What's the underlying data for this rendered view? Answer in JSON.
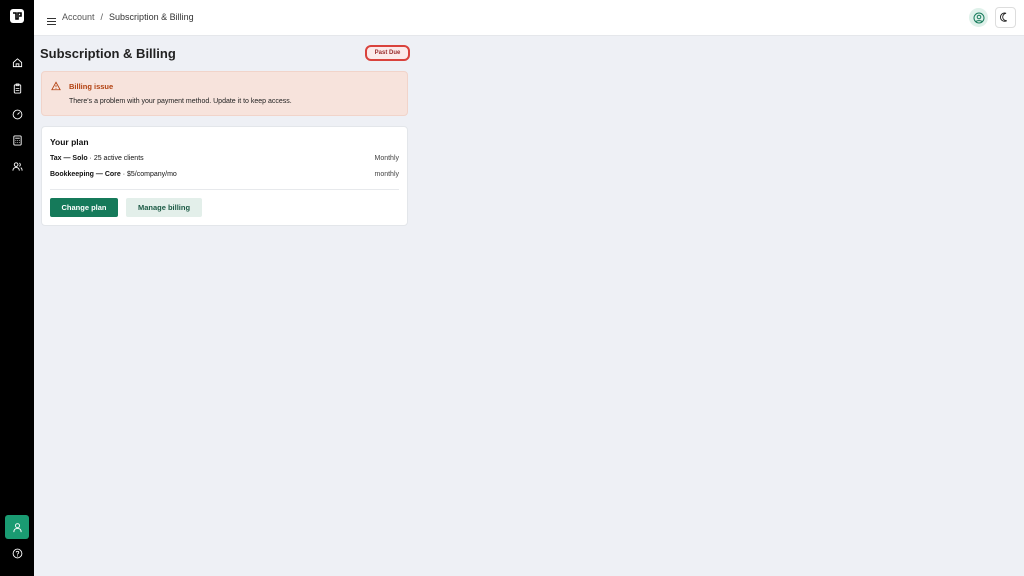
{
  "sidebar": {
    "items": [
      {
        "icon": "home-icon"
      },
      {
        "icon": "clipboard-icon"
      },
      {
        "icon": "gauge-icon"
      },
      {
        "icon": "calculator-icon"
      },
      {
        "icon": "users-icon"
      }
    ],
    "bottom": [
      {
        "icon": "user-icon",
        "active": true
      },
      {
        "icon": "help-icon"
      }
    ]
  },
  "topbar": {
    "breadcrumb": [
      "Account",
      "/",
      "Subscription & Billing"
    ]
  },
  "page": {
    "title": "Subscription & Billing",
    "status_badge": "Past Due"
  },
  "alert": {
    "title": "Billing issue",
    "message": "There's a problem with your payment method. Update it to keep access."
  },
  "plan_card": {
    "title": "Your plan",
    "plans": [
      {
        "name": "Tax — Solo",
        "detail": " · 25 active clients",
        "frequency": "Monthly"
      },
      {
        "name": "Bookkeeping — Core",
        "detail": " · $5/company/mo",
        "frequency": "monthly"
      }
    ],
    "change_plan_label": "Change plan",
    "manage_billing_label": "Manage billing"
  },
  "colors": {
    "accent": "#157a5a",
    "alert_bg": "#f7e3dc",
    "alert_text": "#b2400f",
    "badge_border": "#d9423c"
  }
}
